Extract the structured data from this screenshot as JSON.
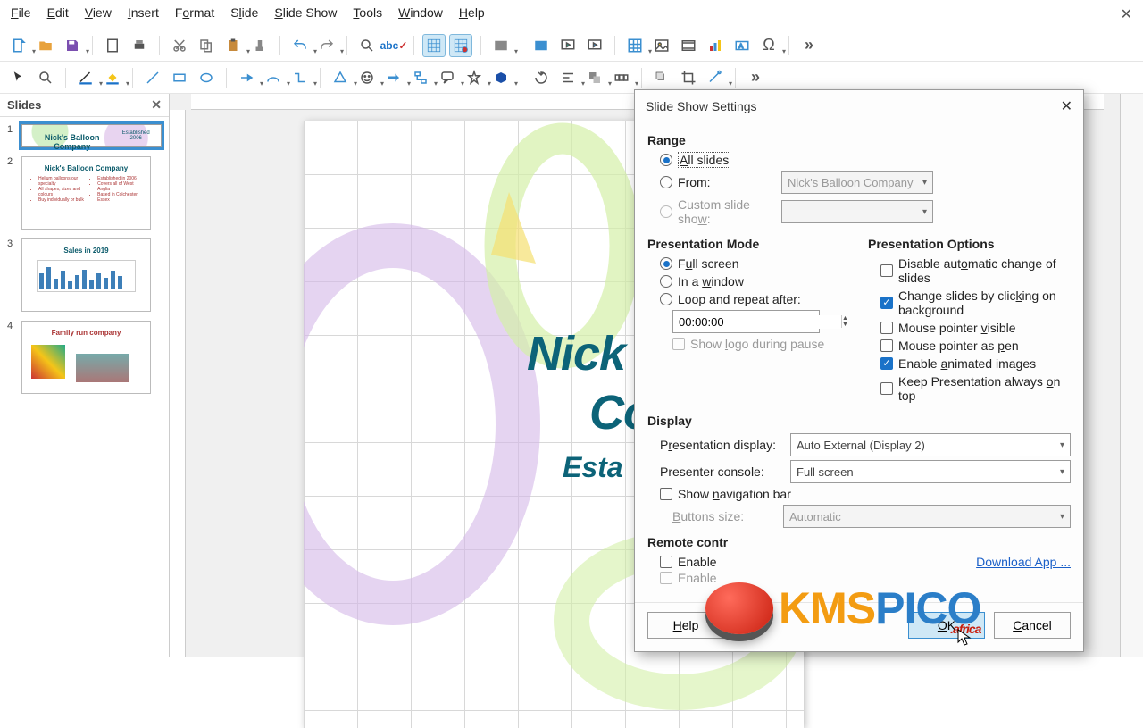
{
  "menu": {
    "items": [
      "File",
      "Edit",
      "View",
      "Insert",
      "Format",
      "Slide",
      "Slide Show",
      "Tools",
      "Window",
      "Help"
    ]
  },
  "slides_panel": {
    "title": "Slides",
    "thumbs": [
      {
        "n": 1,
        "title": "Nick's Balloon Company",
        "sub": "Established 2006"
      },
      {
        "n": 2,
        "title": "Nick's Balloon Company"
      },
      {
        "n": 3,
        "title": "Sales in 2019"
      },
      {
        "n": 4,
        "title": "Family run company"
      }
    ]
  },
  "canvas": {
    "title_l1": "Nick",
    "title_l2": "Co",
    "est": "Esta"
  },
  "dialog": {
    "title": "Slide Show Settings",
    "range": {
      "heading": "Range",
      "all": "All slides",
      "from": "From:",
      "from_value": "Nick's Balloon Company",
      "custom": "Custom slide show:",
      "custom_value": ""
    },
    "mode": {
      "heading": "Presentation Mode",
      "full": "Full screen",
      "window": "In a window",
      "loop": "Loop and repeat after:",
      "loop_time": "00:00:00",
      "logo": "Show logo during pause"
    },
    "options": {
      "heading": "Presentation Options",
      "disable_auto": "Disable automatic change of slides",
      "click_bg": "Change slides by clicking on background",
      "pointer_visible": "Mouse pointer visible",
      "pointer_pen": "Mouse pointer as pen",
      "animated": "Enable animated images",
      "on_top": "Keep Presentation always on top"
    },
    "display": {
      "heading": "Display",
      "pres_display_label": "Presentation display:",
      "pres_display_value": "Auto External (Display 2)",
      "console_label": "Presenter console:",
      "console_value": "Full screen",
      "navbar": "Show navigation bar",
      "buttons_label": "Buttons size:",
      "buttons_value": "Automatic"
    },
    "remote": {
      "heading": "Remote contr",
      "enable": "Enable",
      "enable2": "Enable",
      "download": "Download App ..."
    },
    "buttons": {
      "help": "Help",
      "ok": "OK",
      "cancel": "Cancel"
    }
  },
  "overlay": {
    "text": "KMSPICO",
    "suffix": ".africa"
  }
}
